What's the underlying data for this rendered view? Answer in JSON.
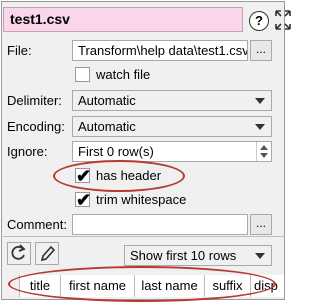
{
  "title": "test1.csv",
  "help_glyph": "?",
  "file": {
    "label": "File:",
    "value": "Transform\\help data\\test1.csv",
    "browse_label": "..."
  },
  "watch_file": {
    "label": "watch file",
    "checked": false
  },
  "delimiter": {
    "label": "Delimiter:",
    "value": "Automatic"
  },
  "encoding": {
    "label": "Encoding:",
    "value": "Automatic"
  },
  "ignore": {
    "label": "Ignore:",
    "value": "First 0 row(s)"
  },
  "has_header": {
    "label": "has header",
    "checked": true,
    "check_glyph": "✔"
  },
  "trim_whitespace": {
    "label": "trim whitespace",
    "checked": true,
    "check_glyph": "✔"
  },
  "comment": {
    "label": "Comment:",
    "value": "",
    "browse_label": "..."
  },
  "show_rows": {
    "value": "Show first 10 rows"
  },
  "preview_columns": [
    "title",
    "first name",
    "last name",
    "suffix",
    "disp"
  ],
  "icons": [
    "help-icon",
    "expand-icon",
    "refresh-icon",
    "pencil-icon"
  ],
  "colors": {
    "title_bg": "#f9d6ea",
    "highlight_ellipse": "#b53a2f"
  }
}
